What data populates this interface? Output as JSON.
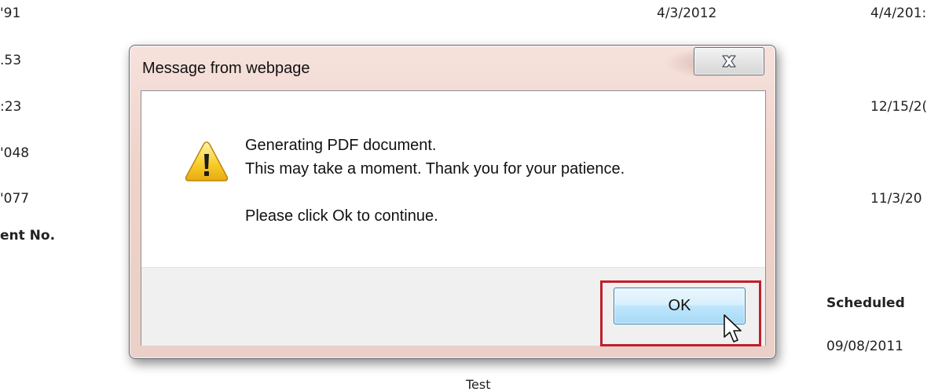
{
  "background": {
    "rows": [
      {
        "left": "'91",
        "date1": "4/3/2012",
        "date2": "4/4/201:"
      },
      {
        "left": ".53",
        "date1": "",
        "date2": ""
      },
      {
        "left": ":23",
        "date1": "",
        "date2": "12/15/2("
      },
      {
        "left": "'048",
        "date1": "",
        "date2": ""
      },
      {
        "left": "'077",
        "date1": "",
        "date2": "11/3/20"
      }
    ],
    "column_header": "ent No.",
    "scheduled_label": "Scheduled",
    "scheduled_date": "09/08/2011",
    "footer_text": "Test"
  },
  "dialog": {
    "title": "Message from webpage",
    "close_glyph": "✕",
    "line1": "Generating PDF document.",
    "line2": "This may take a moment.  Thank you for your patience.",
    "line3": "Please click Ok to continue.",
    "ok_label": "OK",
    "icon": "warning-icon",
    "highlight_color": "#c0202a"
  }
}
